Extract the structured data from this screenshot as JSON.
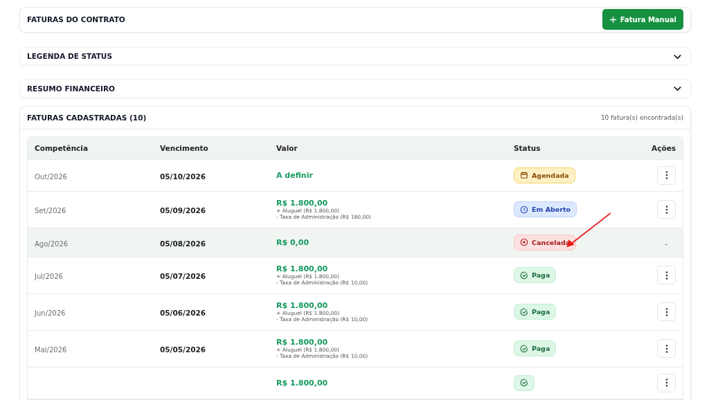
{
  "header": {
    "title": "FATURAS DO CONTRATO",
    "button": "Fatura Manual"
  },
  "sections": [
    {
      "title": "LEGENDA DE STATUS",
      "expanded": false
    },
    {
      "title": "RESUMO FINANCEIRO",
      "expanded": false
    }
  ],
  "invoices": {
    "title": "FATURAS CADASTRADAS (10)",
    "count": "10 fatura(s) encontrada(s)",
    "columns": [
      "Competência",
      "Vencimento",
      "Valor",
      "Status",
      "Ações"
    ],
    "rows": [
      {
        "competencia": "Out/2026",
        "vencimento": "05/10/2026",
        "valor": "A definir",
        "status": {
          "kind": "scheduled",
          "label": "Agendada"
        },
        "menu": true
      },
      {
        "competencia": "Set/2026",
        "vencimento": "05/09/2026",
        "valor": "R$ 1.800,00",
        "details": [
          "+ Aluguel (R$ 1.800,00)",
          "- Taxa de Administração (R$ 180,00)"
        ],
        "status": {
          "kind": "open",
          "label": "Em Aberto"
        },
        "menu": true
      },
      {
        "competencia": "Ago/2026",
        "vencimento": "05/08/2026",
        "valor": "R$ 0,00",
        "status": {
          "kind": "cancelled",
          "label": "Cancelada"
        },
        "menu": false,
        "action_text": "-"
      },
      {
        "competencia": "Jul/2026",
        "vencimento": "05/07/2026",
        "valor": "R$ 1.800,00",
        "details": [
          "+ Aluguel (R$ 1.800,00)",
          "- Taxa de Administração (R$ 10,00)"
        ],
        "status": {
          "kind": "paid",
          "label": "Paga"
        },
        "menu": true
      },
      {
        "competencia": "Jun/2026",
        "vencimento": "05/06/2026",
        "valor": "R$ 1.800,00",
        "details": [
          "+ Aluguel (R$ 1.800,00)",
          "- Taxa de Administração (R$ 10,00)"
        ],
        "status": {
          "kind": "paid",
          "label": "Paga"
        },
        "menu": true
      },
      {
        "competencia": "Mai/2026",
        "vencimento": "05/05/2026",
        "valor": "R$ 1.800,00",
        "details": [
          "+ Aluguel (R$ 1.800,00)",
          "- Taxa de Administração (R$ 10,00)"
        ],
        "status": {
          "kind": "paid",
          "label": "Paga"
        },
        "menu": true
      },
      {
        "valor": "R$ 1.800,00",
        "status": {
          "kind": "paid"
        },
        "menu": true
      }
    ]
  }
}
